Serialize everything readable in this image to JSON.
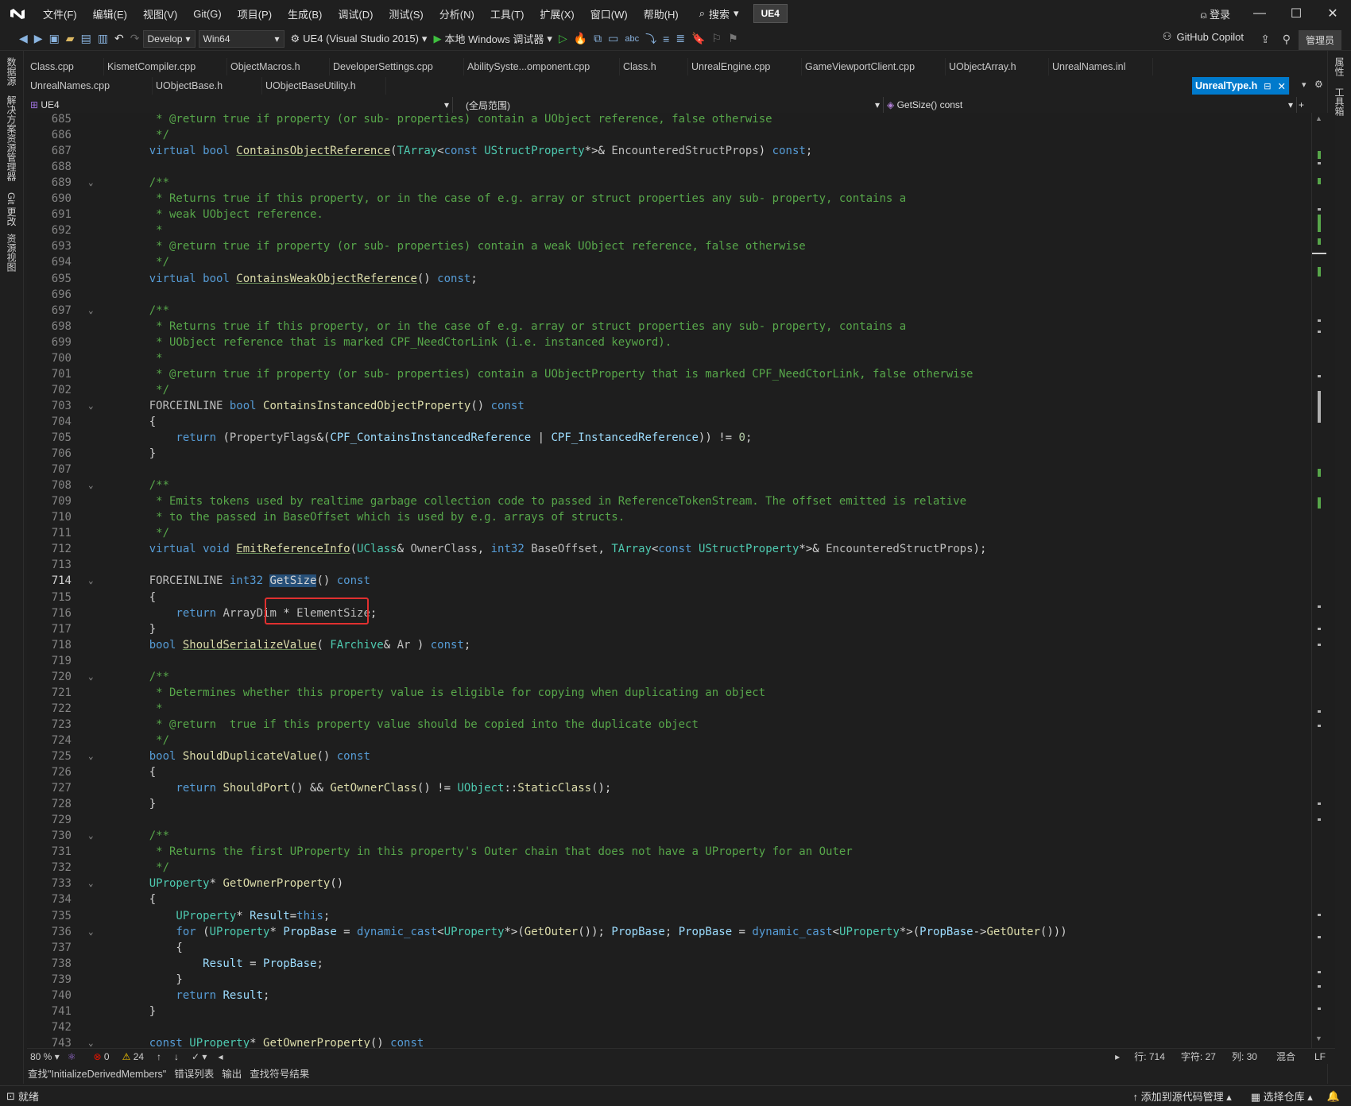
{
  "menu": [
    "文件(F)",
    "编辑(E)",
    "视图(V)",
    "Git(G)",
    "项目(P)",
    "生成(B)",
    "调试(D)",
    "测试(S)",
    "分析(N)",
    "工具(T)",
    "扩展(X)",
    "窗口(W)",
    "帮助(H)"
  ],
  "search_label": "搜索",
  "solution_badge": "UE4",
  "login_label": "登录",
  "toolbar": {
    "config": "Develop",
    "platform": "Win64",
    "startup_project": "UE4 (Visual Studio 2015)",
    "debugger": "本地 Windows 调试器",
    "copilot": "GitHub Copilot",
    "admin": "管理员"
  },
  "left_rail": [
    "数据源",
    "解决方案资源管理器",
    "Git 更改",
    "资源视图"
  ],
  "right_rail": [
    "属性",
    "工具箱"
  ],
  "tabs_row1": [
    "Class.cpp",
    "KismetCompiler.cpp",
    "ObjectMacros.h",
    "DeveloperSettings.cpp",
    "AbilitySyste...omponent.cpp",
    "Class.h",
    "UnrealEngine.cpp",
    "GameViewportClient.cpp",
    "UObjectArray.h",
    "UnrealNames.inl"
  ],
  "tabs_row2": [
    "UnrealNames.cpp",
    "UObjectBase.h",
    "UObjectBaseUtility.h"
  ],
  "active_tab": "UnrealType.h",
  "nav": {
    "project": "UE4",
    "scope": "(全局范围)",
    "member": "GetSize() const"
  },
  "code_lines": [
    {
      "n": "685",
      "f": "",
      "s": [
        [
          "cm",
          "\t * @return true if property (or sub- properties) contain a UObject reference, false otherwise"
        ]
      ]
    },
    {
      "n": "686",
      "f": "",
      "s": [
        [
          "cm",
          "\t */"
        ]
      ]
    },
    {
      "n": "687",
      "f": "",
      "s": [
        [
          "kw",
          "\tvirtual bool "
        ],
        [
          "fn",
          "ContainsObjectReference"
        ],
        [
          "",
          "("
        ],
        [
          "ty",
          "TArray"
        ],
        [
          "",
          "<"
        ],
        [
          "kw",
          "const "
        ],
        [
          "ty",
          "UStructProperty"
        ],
        [
          "",
          "*>& "
        ],
        [
          "mac",
          "EncounteredStructProps"
        ],
        [
          "",
          ") "
        ],
        [
          "kw",
          "const"
        ],
        [
          "",
          ";"
        ]
      ]
    },
    {
      "n": "688",
      "f": "",
      "s": []
    },
    {
      "n": "689",
      "f": "⌄",
      "s": [
        [
          "cm",
          "\t/**"
        ]
      ]
    },
    {
      "n": "690",
      "f": "",
      "s": [
        [
          "cm",
          "\t * Returns true if this property, or in the case of e.g. array or struct properties any sub- property, contains a"
        ]
      ]
    },
    {
      "n": "691",
      "f": "",
      "s": [
        [
          "cm",
          "\t * weak UObject reference."
        ]
      ]
    },
    {
      "n": "692",
      "f": "",
      "s": [
        [
          "cm",
          "\t *"
        ]
      ]
    },
    {
      "n": "693",
      "f": "",
      "s": [
        [
          "cm",
          "\t * @return true if property (or sub- properties) contain a weak UObject reference, false otherwise"
        ]
      ]
    },
    {
      "n": "694",
      "f": "",
      "s": [
        [
          "cm",
          "\t */"
        ]
      ]
    },
    {
      "n": "695",
      "f": "",
      "s": [
        [
          "kw",
          "\tvirtual bool "
        ],
        [
          "fn",
          "ContainsWeakObjectReference"
        ],
        [
          "",
          "() "
        ],
        [
          "kw",
          "const"
        ],
        [
          "",
          ";"
        ]
      ]
    },
    {
      "n": "696",
      "f": "",
      "s": []
    },
    {
      "n": "697",
      "f": "⌄",
      "s": [
        [
          "cm",
          "\t/**"
        ]
      ]
    },
    {
      "n": "698",
      "f": "",
      "s": [
        [
          "cm",
          "\t * Returns true if this property, or in the case of e.g. array or struct properties any sub- property, contains a"
        ]
      ]
    },
    {
      "n": "699",
      "f": "",
      "s": [
        [
          "cm",
          "\t * UObject reference that is marked CPF_NeedCtorLink (i.e. instanced keyword)."
        ]
      ]
    },
    {
      "n": "700",
      "f": "",
      "s": [
        [
          "cm",
          "\t *"
        ]
      ]
    },
    {
      "n": "701",
      "f": "",
      "s": [
        [
          "cm",
          "\t * @return true if property (or sub- properties) contain a UObjectProperty that is marked CPF_NeedCtorLink, false otherwise"
        ]
      ]
    },
    {
      "n": "702",
      "f": "",
      "s": [
        [
          "cm",
          "\t */"
        ]
      ]
    },
    {
      "n": "703",
      "f": "⌄",
      "s": [
        [
          "mac",
          "\tFORCEINLINE "
        ],
        [
          "kw",
          "bool "
        ],
        [
          "fnp",
          "ContainsInstancedObjectProperty"
        ],
        [
          "",
          "() "
        ],
        [
          "kw",
          "const"
        ]
      ]
    },
    {
      "n": "704",
      "f": "",
      "s": [
        [
          "",
          "\t{"
        ]
      ]
    },
    {
      "n": "705",
      "f": "",
      "s": [
        [
          "kw",
          "\t\treturn "
        ],
        [
          "",
          "("
        ],
        [
          "mac",
          "PropertyFlags"
        ],
        [
          "",
          "&("
        ],
        [
          "nm",
          "CPF_ContainsInstancedReference"
        ],
        [
          "",
          " | "
        ],
        [
          "nm",
          "CPF_InstancedReference"
        ],
        [
          "",
          "))"
        ],
        [
          "",
          " != "
        ],
        [
          "num",
          "0"
        ],
        [
          "",
          ";"
        ]
      ]
    },
    {
      "n": "706",
      "f": "",
      "s": [
        [
          "",
          "\t}"
        ]
      ]
    },
    {
      "n": "707",
      "f": "",
      "s": []
    },
    {
      "n": "708",
      "f": "⌄",
      "s": [
        [
          "cm",
          "\t/**"
        ]
      ]
    },
    {
      "n": "709",
      "f": "",
      "s": [
        [
          "cm",
          "\t * Emits tokens used by realtime garbage collection code to passed in ReferenceTokenStream. The offset emitted is relative"
        ]
      ]
    },
    {
      "n": "710",
      "f": "",
      "s": [
        [
          "cm",
          "\t * to the passed in BaseOffset which is used by e.g. arrays of structs."
        ]
      ]
    },
    {
      "n": "711",
      "f": "",
      "s": [
        [
          "cm",
          "\t */"
        ]
      ]
    },
    {
      "n": "712",
      "f": "",
      "s": [
        [
          "kw",
          "\tvirtual void "
        ],
        [
          "fn",
          "EmitReferenceInfo"
        ],
        [
          "",
          "("
        ],
        [
          "ty",
          "UClass"
        ],
        [
          "",
          "& "
        ],
        [
          "mac",
          "OwnerClass"
        ],
        [
          "",
          ", "
        ],
        [
          "kw",
          "int32 "
        ],
        [
          "mac",
          "BaseOffset"
        ],
        [
          "",
          ", "
        ],
        [
          "ty",
          "TArray"
        ],
        [
          "",
          "<"
        ],
        [
          "kw",
          "const "
        ],
        [
          "ty",
          "UStructProperty"
        ],
        [
          "",
          "*>& "
        ],
        [
          "mac",
          "EncounteredStructProps"
        ],
        [
          "",
          ");"
        ]
      ]
    },
    {
      "n": "713",
      "f": "",
      "s": []
    },
    {
      "n": "714",
      "f": "⌄",
      "s": [
        [
          "mac",
          "\tFORCEINLINE "
        ],
        [
          "kw",
          "int32 "
        ],
        [
          "hl",
          "GetSize"
        ],
        [
          "",
          "() "
        ],
        [
          "kw",
          "const"
        ]
      ]
    },
    {
      "n": "715",
      "f": "",
      "s": [
        [
          "",
          "\t{"
        ]
      ]
    },
    {
      "n": "716",
      "f": "",
      "s": [
        [
          "kw",
          "\t\treturn "
        ],
        [
          "mac",
          "ArrayDim"
        ],
        [
          "",
          " * "
        ],
        [
          "mac",
          "ElementSize"
        ],
        [
          "",
          ";"
        ]
      ]
    },
    {
      "n": "717",
      "f": "",
      "s": [
        [
          "",
          "\t}"
        ]
      ]
    },
    {
      "n": "718",
      "f": "",
      "s": [
        [
          "kw",
          "\tbool "
        ],
        [
          "fn",
          "ShouldSerializeValue"
        ],
        [
          "",
          "( "
        ],
        [
          "ty",
          "FArchive"
        ],
        [
          "",
          "& "
        ],
        [
          "mac",
          "Ar"
        ],
        [
          "",
          " ) "
        ],
        [
          "kw",
          "const"
        ],
        [
          "",
          ";"
        ]
      ]
    },
    {
      "n": "719",
      "f": "",
      "s": []
    },
    {
      "n": "720",
      "f": "⌄",
      "s": [
        [
          "cm",
          "\t/**"
        ]
      ]
    },
    {
      "n": "721",
      "f": "",
      "s": [
        [
          "cm",
          "\t * Determines whether this property value is eligible for copying when duplicating an object"
        ]
      ]
    },
    {
      "n": "722",
      "f": "",
      "s": [
        [
          "cm",
          "\t *"
        ]
      ]
    },
    {
      "n": "723",
      "f": "",
      "s": [
        [
          "cm",
          "\t * @return  true if this property value should be copied into the duplicate object"
        ]
      ]
    },
    {
      "n": "724",
      "f": "",
      "s": [
        [
          "cm",
          "\t */"
        ]
      ]
    },
    {
      "n": "725",
      "f": "⌄",
      "s": [
        [
          "kw",
          "\tbool "
        ],
        [
          "fnp",
          "ShouldDuplicateValue"
        ],
        [
          "",
          "() "
        ],
        [
          "kw",
          "const"
        ]
      ]
    },
    {
      "n": "726",
      "f": "",
      "s": [
        [
          "",
          "\t{"
        ]
      ]
    },
    {
      "n": "727",
      "f": "",
      "s": [
        [
          "kw",
          "\t\treturn "
        ],
        [
          "fnp",
          "ShouldPort"
        ],
        [
          "",
          "() && "
        ],
        [
          "fnp",
          "GetOwnerClass"
        ],
        [
          "",
          "() != "
        ],
        [
          "ty",
          "UObject"
        ],
        [
          "",
          "::"
        ],
        [
          "fnp",
          "StaticClass"
        ],
        [
          "",
          "();"
        ]
      ]
    },
    {
      "n": "728",
      "f": "",
      "s": [
        [
          "",
          "\t}"
        ]
      ]
    },
    {
      "n": "729",
      "f": "",
      "s": []
    },
    {
      "n": "730",
      "f": "⌄",
      "s": [
        [
          "cm",
          "\t/**"
        ]
      ]
    },
    {
      "n": "731",
      "f": "",
      "s": [
        [
          "cm",
          "\t * Returns the first UProperty in this property's Outer chain that does not have a UProperty for an Outer"
        ]
      ]
    },
    {
      "n": "732",
      "f": "",
      "s": [
        [
          "cm",
          "\t */"
        ]
      ]
    },
    {
      "n": "733",
      "f": "⌄",
      "s": [
        [
          "ty",
          "\tUProperty"
        ],
        [
          "",
          "* "
        ],
        [
          "fnp",
          "GetOwnerProperty"
        ],
        [
          "",
          "()"
        ]
      ]
    },
    {
      "n": "734",
      "f": "",
      "s": [
        [
          "",
          "\t{"
        ]
      ]
    },
    {
      "n": "735",
      "f": "",
      "s": [
        [
          "ty",
          "\t\tUProperty"
        ],
        [
          "",
          "* "
        ],
        [
          "nm",
          "Result"
        ],
        [
          "",
          "="
        ],
        [
          "kw",
          "this"
        ],
        [
          "",
          ";"
        ]
      ]
    },
    {
      "n": "736",
      "f": "⌄",
      "s": [
        [
          "kw",
          "\t\tfor "
        ],
        [
          "",
          "("
        ],
        [
          "ty",
          "UProperty"
        ],
        [
          "",
          "* "
        ],
        [
          "nm",
          "PropBase"
        ],
        [
          "",
          " = "
        ],
        [
          "kw",
          "dynamic_cast"
        ],
        [
          "",
          "<"
        ],
        [
          "ty",
          "UProperty"
        ],
        [
          "",
          "*>("
        ],
        [
          "fnp",
          "GetOuter"
        ],
        [
          "",
          "()); "
        ],
        [
          "nm",
          "PropBase"
        ],
        [
          "",
          "; "
        ],
        [
          "nm",
          "PropBase"
        ],
        [
          "",
          " = "
        ],
        [
          "kw",
          "dynamic_cast"
        ],
        [
          "",
          "<"
        ],
        [
          "ty",
          "UProperty"
        ],
        [
          "",
          "*>("
        ],
        [
          "nm",
          "PropBase"
        ],
        [
          "",
          "->"
        ],
        [
          "fnp",
          "GetOuter"
        ],
        [
          "",
          "()))"
        ]
      ]
    },
    {
      "n": "737",
      "f": "",
      "s": [
        [
          "",
          "\t\t{"
        ]
      ]
    },
    {
      "n": "738",
      "f": "",
      "s": [
        [
          "nm",
          "\t\t\tResult"
        ],
        [
          "",
          " = "
        ],
        [
          "nm",
          "PropBase"
        ],
        [
          "",
          ";"
        ]
      ]
    },
    {
      "n": "739",
      "f": "",
      "s": [
        [
          "",
          "\t\t}"
        ]
      ]
    },
    {
      "n": "740",
      "f": "",
      "s": [
        [
          "kw",
          "\t\treturn "
        ],
        [
          "nm",
          "Result"
        ],
        [
          "",
          ";"
        ]
      ]
    },
    {
      "n": "741",
      "f": "",
      "s": [
        [
          "",
          "\t}"
        ]
      ]
    },
    {
      "n": "742",
      "f": "",
      "s": []
    },
    {
      "n": "743",
      "f": "⌄",
      "s": [
        [
          "kw",
          "\tconst "
        ],
        [
          "ty",
          "UProperty"
        ],
        [
          "",
          "* "
        ],
        [
          "fnp",
          "GetOwnerProperty"
        ],
        [
          "",
          "() "
        ],
        [
          "kw",
          "const"
        ]
      ]
    }
  ],
  "status": {
    "zoom": "80 %",
    "errors": "0",
    "warnings": "24",
    "line": "行: 714",
    "char": "字符: 27",
    "col": "列: 30",
    "mixed": "混合",
    "eol": "LF"
  },
  "bottom_tabs": [
    "查找\"InitializeDerivedMembers\"",
    "错误列表",
    "输出",
    "查找符号结果"
  ],
  "footer": {
    "ready": "就绪",
    "add_source": "添加到源代码管理",
    "select_repo": "选择仓库"
  },
  "colors": {
    "accent": "#007acc",
    "comment": "#57a64a",
    "keyword": "#569cd6",
    "type": "#4ec9b0",
    "function": "#dcdcaa"
  }
}
